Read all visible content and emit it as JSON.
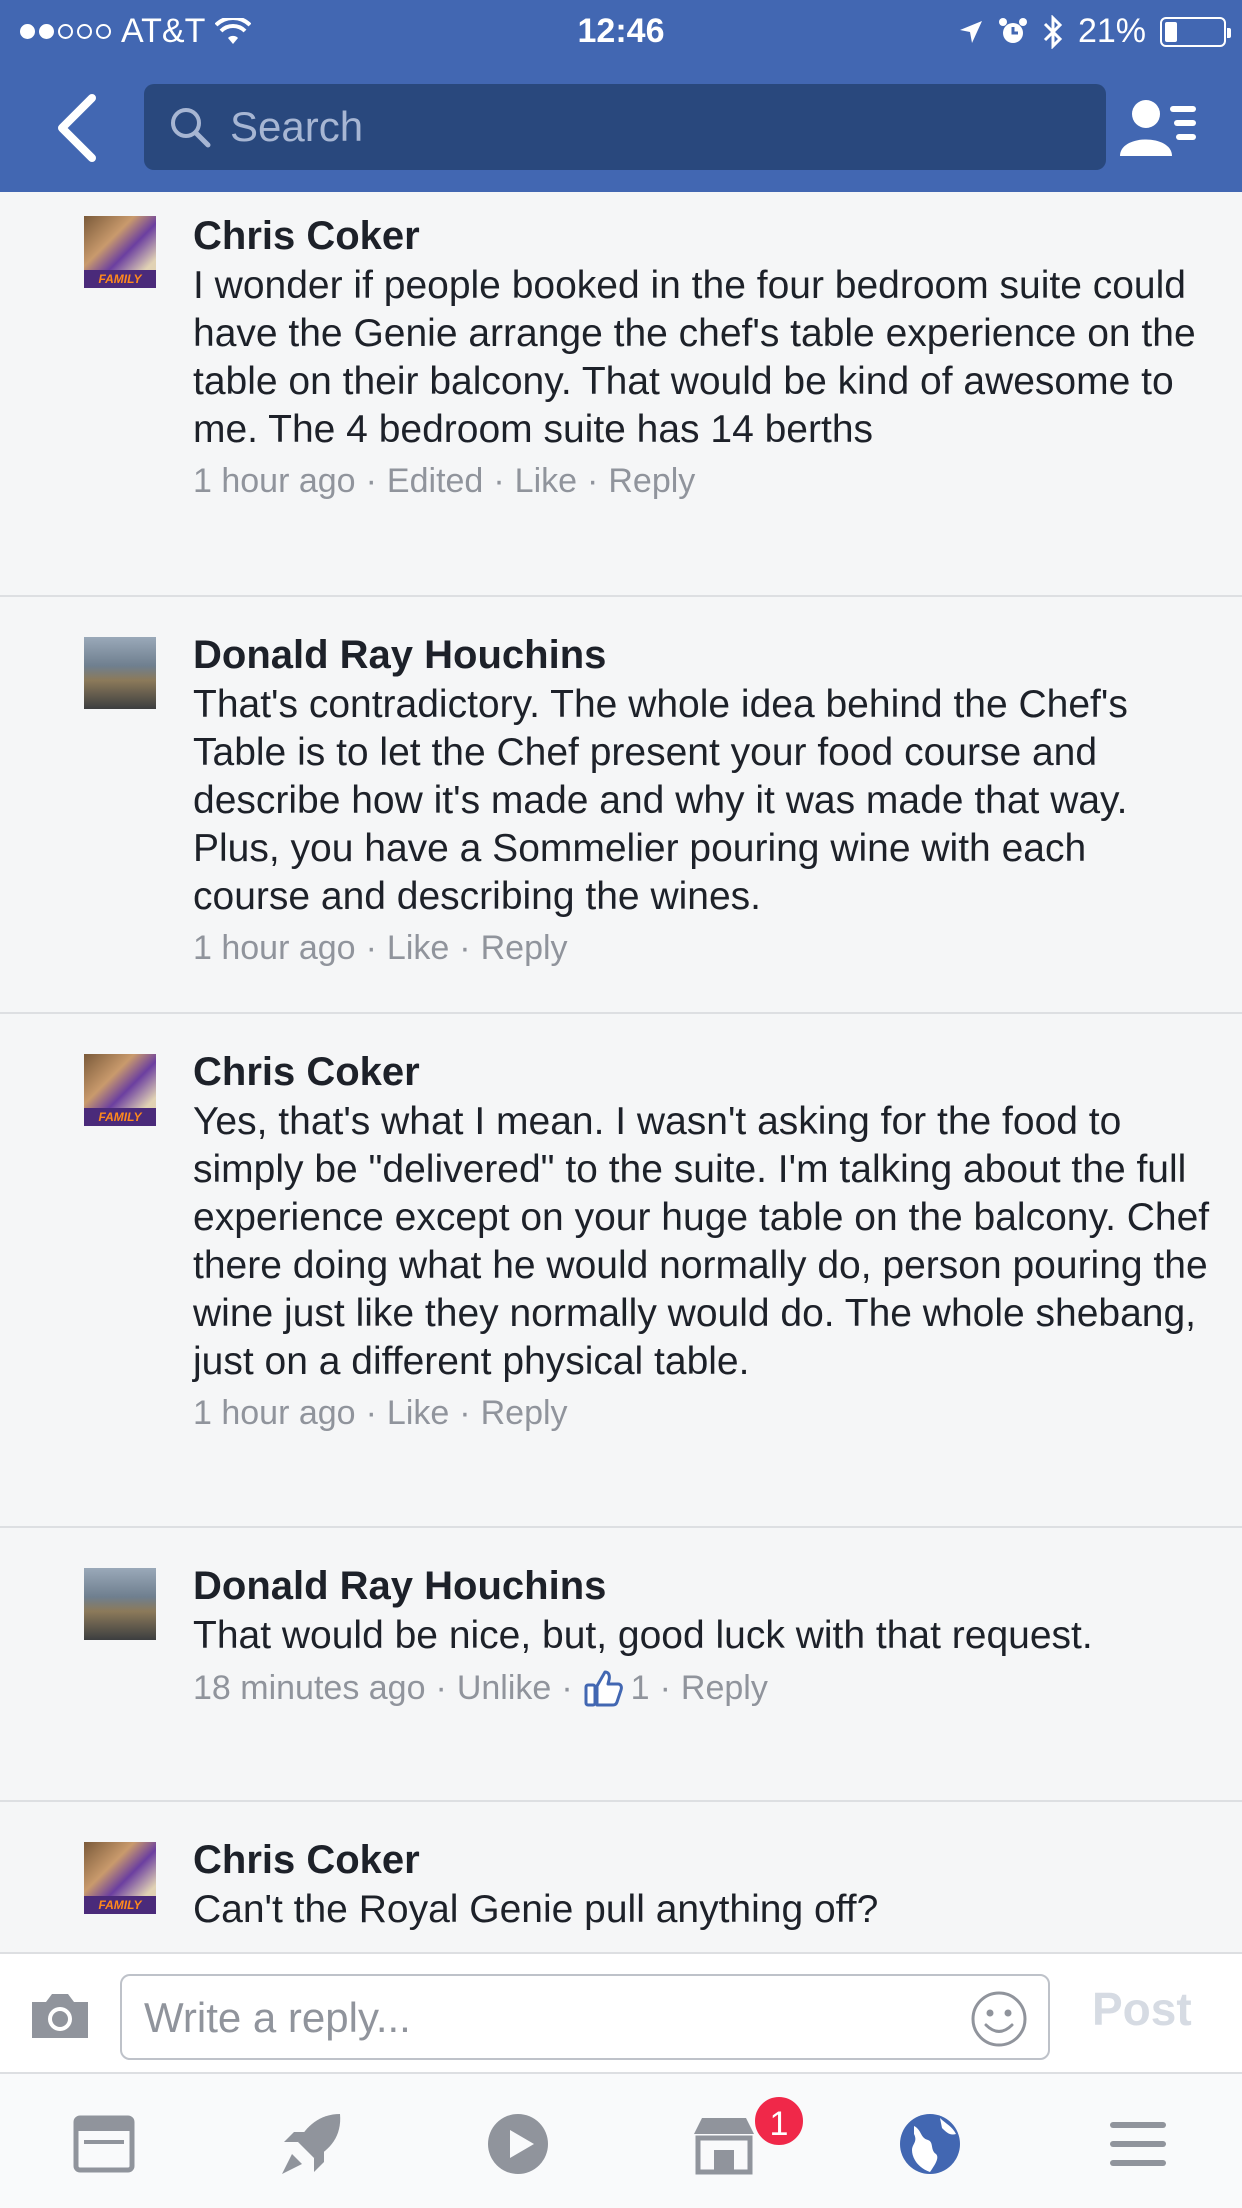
{
  "status_bar": {
    "carrier": "AT&T",
    "time": "12:46",
    "battery": "21%",
    "battery_level": 0.21,
    "signal_bars": 2
  },
  "nav": {
    "search_placeholder": "Search",
    "back_icon": "chevron-left-icon",
    "friends_icon": "friend-list-icon"
  },
  "colors": {
    "brand": "#4267b2",
    "search_bg": "#29487d",
    "meta_text": "#90949c",
    "like_blue": "#4267b2",
    "badge_red": "#f02849"
  },
  "comments": [
    {
      "author": "Chris Coker",
      "text": "I wonder if people booked in the four bedroom suite could have the Genie arrange the chef's table experience on the table on their balcony. That would be kind of awesome to me. The 4 bedroom suite has 14 berths",
      "time": "1 hour ago",
      "edited": "Edited",
      "like": "Like",
      "reply": "Reply"
    },
    {
      "author": "Donald Ray Houchins",
      "text": "That's contradictory. The whole idea behind the Chef's Table is to let the Chef present your food course and describe how it's made and why it was made that way. Plus, you have a Sommelier pouring wine with each course and describing the wines.",
      "time": "1 hour ago",
      "like": "Like",
      "reply": "Reply"
    },
    {
      "author": "Chris Coker",
      "text": "Yes, that's what I mean. I wasn't asking for the food to simply be \"delivered\" to the suite. I'm talking about the full experience except on your huge table on the balcony. Chef there doing what he would normally do, person pouring the wine just like they normally would do. The whole shebang, just on a different physical table.",
      "time": "1 hour ago",
      "like": "Like",
      "reply": "Reply"
    },
    {
      "author": "Donald Ray Houchins",
      "text": "That would be nice, but, good luck with that request.",
      "time": "18 minutes ago",
      "unlike": "Unlike",
      "like_count": "1",
      "reply": "Reply"
    },
    {
      "author": "Chris Coker",
      "text": "Can't the Royal Genie pull anything off?"
    }
  ],
  "avatar_tag": "FAMILY",
  "composer": {
    "placeholder": "Write a reply...",
    "post_label": "Post",
    "camera_icon": "camera-icon",
    "emoji_icon": "smiley-icon"
  },
  "tabbar": {
    "items": [
      "news-feed-icon",
      "rocket-icon",
      "video-play-icon",
      "marketplace-icon",
      "globe-icon",
      "menu-icon"
    ],
    "marketplace_badge": "1"
  }
}
